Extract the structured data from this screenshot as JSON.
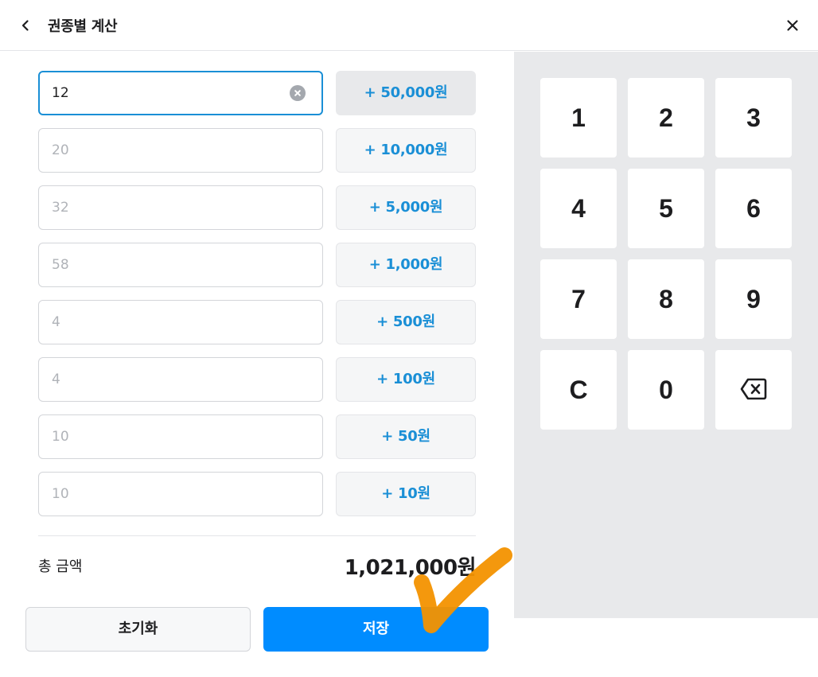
{
  "header": {
    "title": "권종별 계산",
    "back_icon": "chevron-left-icon",
    "close_icon": "close-icon"
  },
  "denominations": [
    {
      "count": "12",
      "button_label": "+ 50,000원",
      "active": true
    },
    {
      "count": "20",
      "button_label": "+ 10,000원",
      "active": false
    },
    {
      "count": "32",
      "button_label": "+ 5,000원",
      "active": false
    },
    {
      "count": "58",
      "button_label": "+ 1,000원",
      "active": false
    },
    {
      "count": "4",
      "button_label": "+ 500원",
      "active": false
    },
    {
      "count": "4",
      "button_label": "+ 100원",
      "active": false
    },
    {
      "count": "10",
      "button_label": "+ 50원",
      "active": false
    },
    {
      "count": "10",
      "button_label": "+ 10원",
      "active": false
    }
  ],
  "total": {
    "label": "총 금액",
    "value": "1,021,000원"
  },
  "actions": {
    "reset_label": "초기화",
    "save_label": "저장"
  },
  "keypad": {
    "keys": [
      "1",
      "2",
      "3",
      "4",
      "5",
      "6",
      "7",
      "8",
      "9",
      "C",
      "0",
      "backspace-icon"
    ]
  },
  "colors": {
    "accent": "#008cff",
    "link_blue": "#1a8fd6",
    "panel_bg": "#e8e9eb",
    "annotation_check": "#f39200"
  }
}
